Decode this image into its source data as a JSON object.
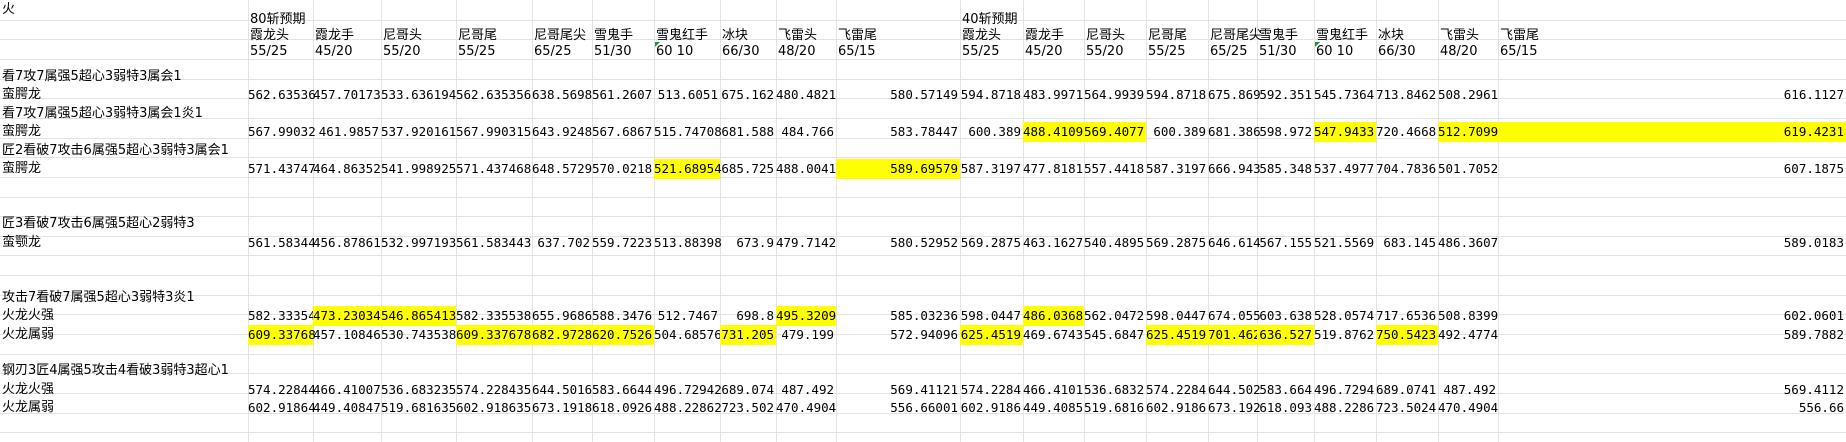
{
  "sheet": {
    "corner_label": "火",
    "section80": {
      "title": "80斩预期",
      "headers": [
        [
          "霞龙头",
          "55/25"
        ],
        [
          "霞龙手",
          "45/20"
        ],
        [
          "尼哥头",
          "55/20"
        ],
        [
          "尼哥尾",
          "55/25"
        ],
        [
          "尼哥尾尖",
          "65/25"
        ],
        [
          "雪鬼手",
          "51/30"
        ],
        [
          "雪鬼红手",
          "60  10"
        ],
        [
          "冰块",
          "66/30"
        ],
        [
          "飞雷头",
          "48/20"
        ],
        [
          "飞雷尾",
          "65/15"
        ]
      ]
    },
    "section40": {
      "title": "40斩预期",
      "headers": [
        [
          "霞龙头",
          "55/25"
        ],
        [
          "霞龙手",
          "45/20"
        ],
        [
          "尼哥头",
          "55/20"
        ],
        [
          "尼哥尾",
          "55/25"
        ],
        [
          "尼哥尾尖",
          "65/25"
        ],
        [
          "雪鬼手",
          "51/30"
        ],
        [
          "雪鬼红手",
          "60  10"
        ],
        [
          "冰块",
          "66/30"
        ],
        [
          "飞雷头",
          "48/20"
        ],
        [
          "飞雷尾",
          "65/15"
        ]
      ]
    },
    "rows": [
      {
        "label": "看7攻7属强5超心3弱特3属会1",
        "v80": [],
        "v40": [],
        "h80": [],
        "h40": []
      },
      {
        "label": "蛮腭龙",
        "v80": [
          "562.63536",
          "457.70173",
          "533.636194",
          "562.635356",
          "638.5698",
          "561.2607",
          "513.6051",
          "675.162",
          "480.4821",
          "580.57149"
        ],
        "v40": [
          "594.8718",
          "483.9971",
          "564.9939",
          "594.8718",
          "675.869",
          "592.351",
          "545.7364",
          "713.8462",
          "508.2961",
          "616.1127"
        ],
        "h80": [],
        "h40": []
      },
      {
        "label": "看7攻7属强5超心3弱特3属会1炎1",
        "v80": [],
        "v40": [],
        "h80": [],
        "h40": []
      },
      {
        "label": "蛮腭龙",
        "v80": [
          "567.99032",
          "461.9857",
          "537.920161",
          "567.990315",
          "643.9248",
          "567.6867",
          "515.74708",
          "681.588",
          "484.766",
          "583.78447"
        ],
        "v40": [
          "600.389",
          "488.4109",
          "569.4077",
          "600.389",
          "681.386",
          "598.972",
          "547.9433",
          "720.4668",
          "512.7099",
          "619.4231"
        ],
        "h80": [],
        "h40": [
          1,
          2,
          6,
          8,
          9
        ]
      },
      {
        "label": "匠2看破7攻击6属强5超心3弱特3属会1",
        "v80": [],
        "v40": [],
        "h80": [],
        "h40": []
      },
      {
        "label": "蛮腭龙",
        "v80": [
          "571.43747",
          "464.86352",
          "541.998925",
          "571.437468",
          "648.5729",
          "570.0218",
          "521.68954",
          "685.725",
          "488.0041",
          "589.69579"
        ],
        "v40": [
          "587.3197",
          "477.8181",
          "557.4418",
          "587.3197",
          "666.943",
          "585.348",
          "537.4977",
          "704.7836",
          "501.7052",
          "607.1875"
        ],
        "h80": [
          6,
          9
        ],
        "h40": []
      },
      {
        "label": "",
        "v80": [],
        "v40": [],
        "h80": [],
        "h40": []
      },
      {
        "label": "",
        "v80": [],
        "v40": [],
        "h80": [],
        "h40": []
      },
      {
        "label": "匠3看破7攻击6属强5超心2弱特3",
        "v80": [],
        "v40": [],
        "h80": [],
        "h40": []
      },
      {
        "label": "蛮颚龙",
        "v80": [
          "561.58344",
          "456.87861",
          "532.997193",
          "561.583443",
          "637.702",
          "559.7223",
          "513.88398",
          "673.9",
          "479.7142",
          "580.52952"
        ],
        "v40": [
          "569.2875",
          "463.1627",
          "540.4895",
          "569.2875",
          "646.614",
          "567.155",
          "521.5569",
          "683.145",
          "486.3607",
          "589.0183"
        ],
        "h80": [],
        "h40": []
      },
      {
        "label": "",
        "v80": [],
        "v40": [],
        "h80": [],
        "h40": []
      },
      {
        "label": "",
        "v80": [],
        "v40": [],
        "h80": [],
        "h40": []
      },
      {
        "label": "攻击7看破7属强5超心3弱特3炎1",
        "v80": [],
        "v40": [],
        "h80": [],
        "h40": []
      },
      {
        "label": "火龙火强",
        "v80": [
          "582.33354",
          "473.23034",
          "546.865413",
          "582.335538",
          "655.9686",
          "588.3476",
          "512.7467",
          "698.8",
          "495.3209",
          "585.03236"
        ],
        "v40": [
          "598.0447",
          "486.0368",
          "562.0472",
          "598.0447",
          "674.055",
          "603.638",
          "528.0574",
          "717.6536",
          "508.8399",
          "602.0601"
        ],
        "h80": [
          1,
          2,
          8
        ],
        "h40": [
          1
        ]
      },
      {
        "label": "火龙属弱",
        "v80": [
          "609.33768",
          "457.10846",
          "530.743538",
          "609.337678",
          "682.9728",
          "620.7526",
          "504.68576",
          "731.205",
          "479.199",
          "572.94096"
        ],
        "v40": [
          "625.4519",
          "469.6743",
          "545.6847",
          "625.4519",
          "701.462",
          "636.527",
          "519.8762",
          "750.5423",
          "492.4774",
          "589.7882"
        ],
        "h80": [
          0,
          3,
          4,
          5,
          7
        ],
        "h40": [
          0,
          3,
          4,
          5,
          7
        ]
      },
      {
        "label": "",
        "v80": [],
        "v40": [],
        "h80": [],
        "h40": []
      },
      {
        "label": "钢刃3匠4属强5攻击4看破3弱特3超心1",
        "v80": [],
        "v40": [],
        "h80": [],
        "h40": []
      },
      {
        "label": "火龙火强",
        "v80": [
          "574.22844",
          "466.41007",
          "536.683235",
          "574.228435",
          "644.5016",
          "583.6644",
          "496.72942",
          "689.074",
          "487.492",
          "569.41121"
        ],
        "v40": [
          "574.2284",
          "466.4101",
          "536.6832",
          "574.2284",
          "644.502",
          "583.664",
          "496.7294",
          "689.0741",
          "487.492",
          "569.4112"
        ],
        "h80": [],
        "h40": []
      },
      {
        "label": "火龙属弱",
        "v80": [
          "602.91864",
          "449.40847",
          "519.681635",
          "602.918635",
          "673.1918",
          "618.0926",
          "488.22862",
          "723.502",
          "470.4904",
          "556.66001"
        ],
        "v40": [
          "602.9186",
          "449.4085",
          "519.6816",
          "602.9186",
          "673.192",
          "618.093",
          "488.2286",
          "723.5024",
          "470.4904",
          "556.66"
        ],
        "h80": [],
        "h40": []
      }
    ],
    "colors": {
      "highlight": "#ffff00",
      "grid": "#e3e3e3",
      "comment_marker": "#1a9641"
    }
  }
}
